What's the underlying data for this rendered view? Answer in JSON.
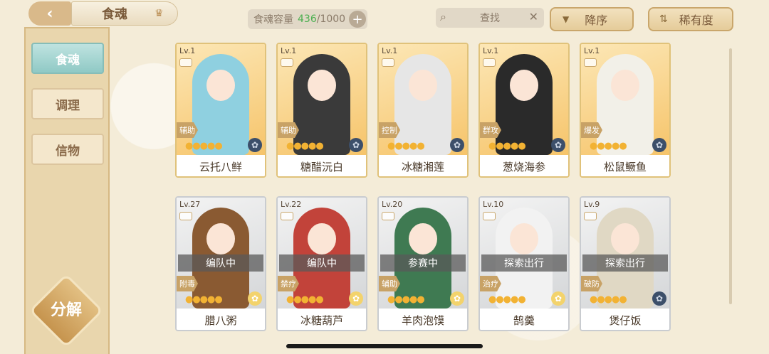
{
  "header": {
    "title": "食魂",
    "capacity_label": "食魂容量",
    "capacity_current": "436",
    "capacity_max": "/1000",
    "capacity_add": "+",
    "search_label": "查找",
    "search_clear": "✕",
    "sort_order": "降序",
    "sort_by": "稀有度"
  },
  "sidebar": {
    "items": [
      {
        "label": "食魂"
      },
      {
        "label": "调理"
      },
      {
        "label": "信物"
      }
    ],
    "decompose": "分解"
  },
  "cards": [
    {
      "level": "Lv.1",
      "name": "云托八鲜",
      "role": "辅助",
      "status": "",
      "stars": 5,
      "dot": "blue",
      "palette": "#8fd0e0"
    },
    {
      "level": "Lv.1",
      "name": "糖醋沅白",
      "role": "辅助",
      "status": "",
      "stars": 5,
      "dot": "blue",
      "palette": "#3a3a3a"
    },
    {
      "level": "Lv.1",
      "name": "冰糖湘莲",
      "role": "控制",
      "status": "",
      "stars": 5,
      "dot": "blue",
      "palette": "#e6e6e6"
    },
    {
      "level": "Lv.1",
      "name": "葱烧海参",
      "role": "群攻",
      "status": "",
      "stars": 5,
      "dot": "blue",
      "palette": "#2a2a2a"
    },
    {
      "level": "Lv.1",
      "name": "松鼠鳜鱼",
      "role": "爆发",
      "status": "",
      "stars": 5,
      "dot": "blue",
      "palette": "#f2f0e8"
    },
    {
      "level": "Lv.27",
      "name": "腊八粥",
      "role": "附毒",
      "status": "编队中",
      "stars": 5,
      "dot": "gold",
      "palette": "#8a5a32"
    },
    {
      "level": "Lv.22",
      "name": "冰糖葫芦",
      "role": "禁疗",
      "status": "编队中",
      "stars": 5,
      "dot": "gold",
      "palette": "#c2433a"
    },
    {
      "level": "Lv.20",
      "name": "羊肉泡馍",
      "role": "辅助",
      "status": "参赛中",
      "stars": 5,
      "dot": "gold",
      "palette": "#3f7a52"
    },
    {
      "level": "Lv.10",
      "name": "鹄羹",
      "role": "治疗",
      "status": "探索出行",
      "stars": 5,
      "dot": "gold",
      "palette": "#f2f2f2"
    },
    {
      "level": "Lv.9",
      "name": "煲仔饭",
      "role": "破防",
      "status": "探索出行",
      "stars": 5,
      "dot": "blue",
      "palette": "#e0d8c4"
    }
  ]
}
